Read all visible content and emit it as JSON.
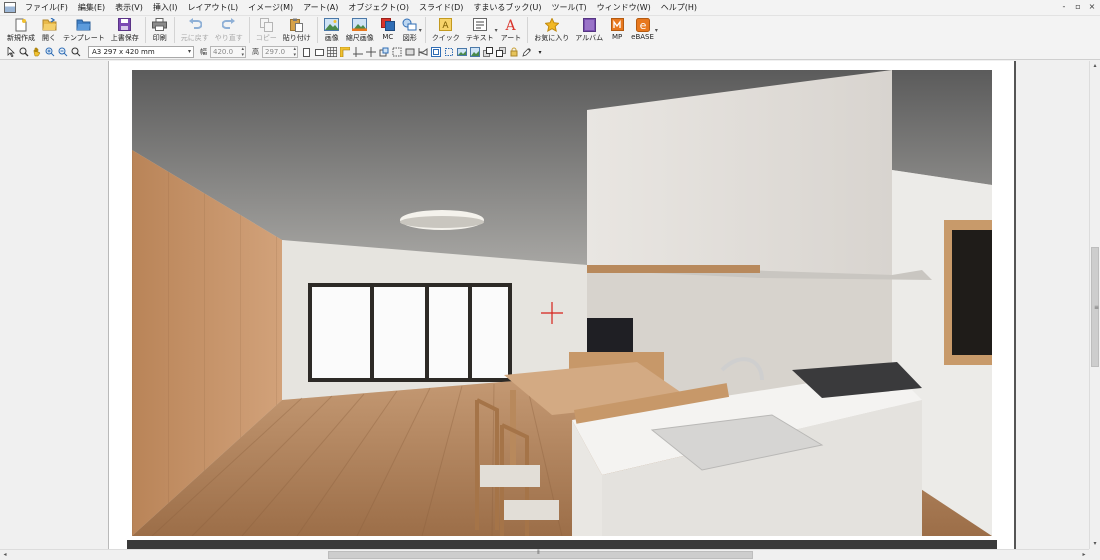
{
  "menu": [
    "ファイル(F)",
    "編集(E)",
    "表示(V)",
    "挿入(I)",
    "レイアウト(L)",
    "イメージ(M)",
    "アート(A)",
    "オブジェクト(O)",
    "スライド(D)",
    "すまいるブック(U)",
    "ツール(T)",
    "ウィンドウ(W)",
    "ヘルプ(H)"
  ],
  "window_controls": [
    "-",
    "▫",
    "×"
  ],
  "toolbar": {
    "new": "新規作成",
    "open": "開く",
    "template": "テンプレート",
    "save": "上書保存",
    "print": "印刷",
    "undo": "元に戻す",
    "redo": "やり直す",
    "copy": "コピー",
    "paste": "貼り付け",
    "image": "画像",
    "scale_image": "縮尺画像",
    "mc": "MC",
    "shape": "図形",
    "quick": "クイック",
    "text": "テキスト",
    "art": "アート",
    "favorites": "お気に入り",
    "album": "アルバム",
    "mp": "MP",
    "ebase": "eBASE"
  },
  "toolbar2": {
    "paper_size": "A3 297 x 420 mm",
    "width_label": "幅",
    "width_value": "420.0",
    "height_label": "高",
    "height_value": "297.0"
  },
  "colors": {
    "accent_blue": "#2f6db5",
    "brand_orange": "#e8781e",
    "art_red": "#d9342b",
    "album_purple": "#7a4fb0",
    "favorites_gold": "#e3a21a"
  }
}
